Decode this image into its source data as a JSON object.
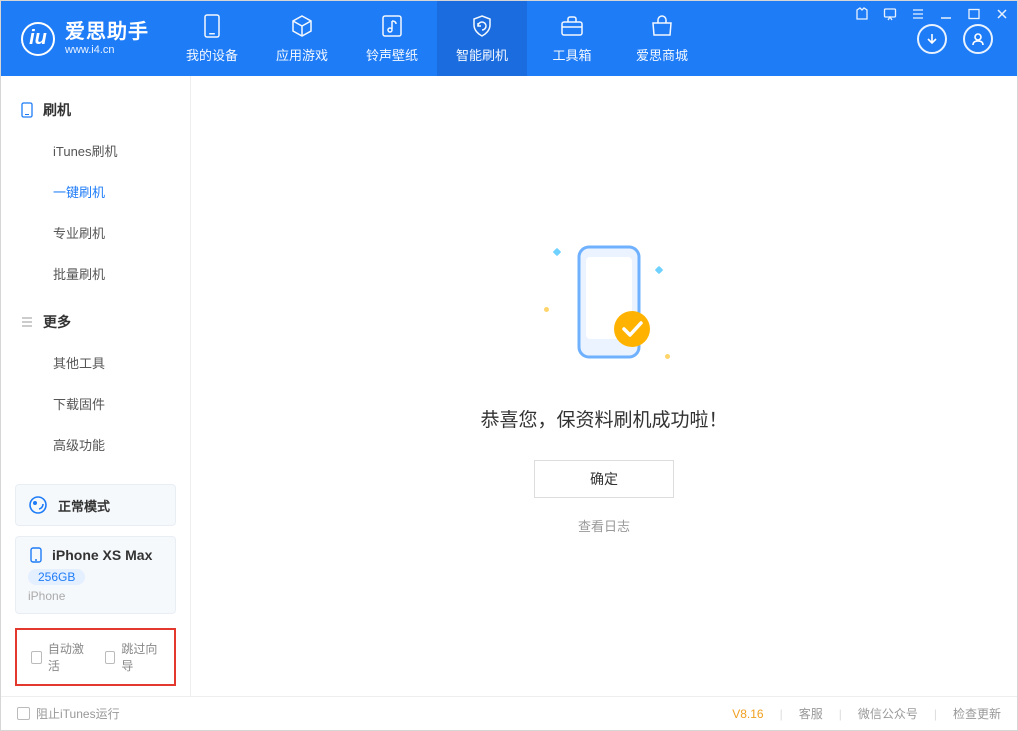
{
  "app": {
    "name": "爱思助手",
    "domain": "www.i4.cn"
  },
  "nav": {
    "tabs": [
      {
        "label": "我的设备"
      },
      {
        "label": "应用游戏"
      },
      {
        "label": "铃声壁纸"
      },
      {
        "label": "智能刷机"
      },
      {
        "label": "工具箱"
      },
      {
        "label": "爱思商城"
      }
    ]
  },
  "sidebar": {
    "group1": {
      "title": "刷机",
      "items": [
        {
          "label": "iTunes刷机"
        },
        {
          "label": "一键刷机"
        },
        {
          "label": "专业刷机"
        },
        {
          "label": "批量刷机"
        }
      ]
    },
    "group2": {
      "title": "更多",
      "items": [
        {
          "label": "其他工具"
        },
        {
          "label": "下载固件"
        },
        {
          "label": "高级功能"
        }
      ]
    },
    "mode": {
      "label": "正常模式"
    },
    "device": {
      "name": "iPhone XS Max",
      "capacity": "256GB",
      "type": "iPhone"
    },
    "options": {
      "autoActivate": "自动激活",
      "skipGuide": "跳过向导"
    }
  },
  "main": {
    "successTitle": "恭喜您，保资料刷机成功啦！",
    "confirm": "确定",
    "viewLog": "查看日志"
  },
  "footer": {
    "blockItunes": "阻止iTunes运行",
    "version": "V8.16",
    "links": {
      "support": "客服",
      "wechat": "微信公众号",
      "update": "检查更新"
    }
  }
}
